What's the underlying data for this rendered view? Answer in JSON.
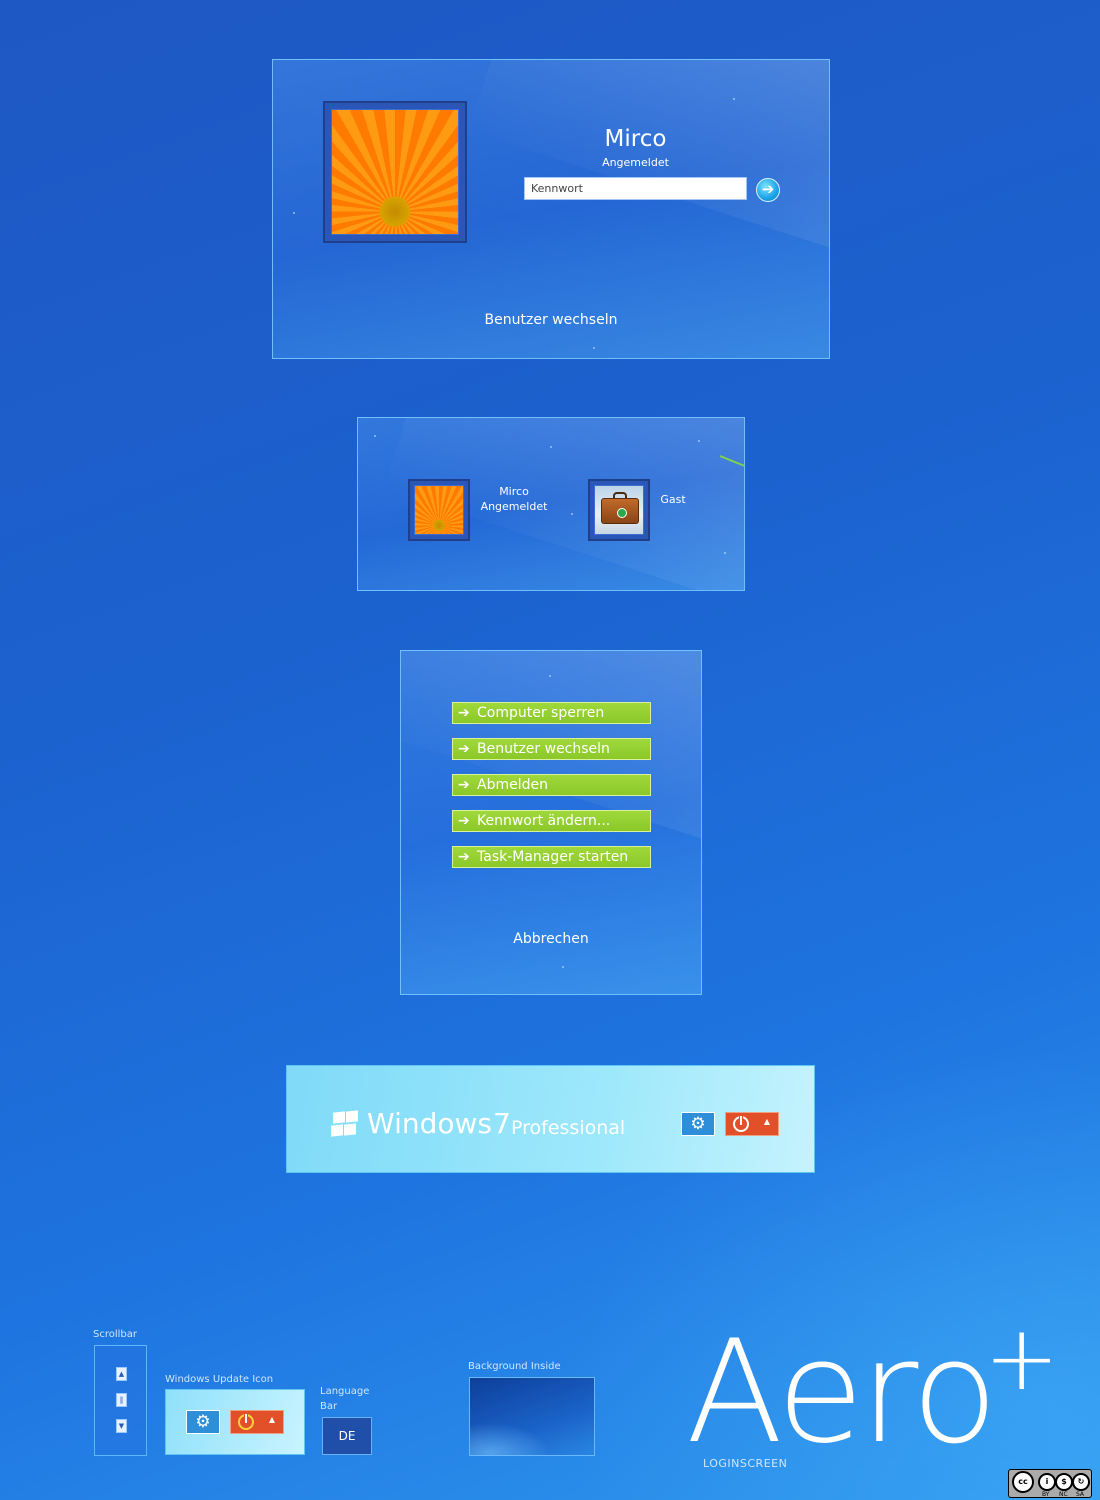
{
  "login_panel": {
    "user_name": "Mirco",
    "user_status": "Angemeldet",
    "password_placeholder": "Kennwort",
    "submit_icon": "arrow-right-icon",
    "switch_user_label": "Benutzer wechseln"
  },
  "user_tiles": [
    {
      "name": "Mirco",
      "status": "Angemeldet"
    },
    {
      "name": "Gast",
      "status": ""
    }
  ],
  "options_panel": {
    "items": [
      "Computer sperren",
      "Benutzer wechseln",
      "Abmelden",
      "Kennwort ändern...",
      "Task-Manager starten"
    ],
    "cancel_label": "Abbrechen"
  },
  "branding": {
    "product": "Windows",
    "version": "7",
    "edition": "Professional"
  },
  "legend": {
    "scrollbar_label": "Scrollbar",
    "update_icon_label": "Windows Update Icon",
    "language_bar_label": "Language Bar",
    "language_code": "DE",
    "background_label": "Background Inside"
  },
  "title": {
    "main": "Aero",
    "plus": "+",
    "subtitle": "LOGINSCREEN"
  },
  "license": {
    "terms": [
      "BY",
      "NC",
      "SA"
    ]
  },
  "colors": {
    "accent_green": "#8cc82a",
    "power_red": "#e2502a",
    "panel_border": "#78c8ff"
  }
}
